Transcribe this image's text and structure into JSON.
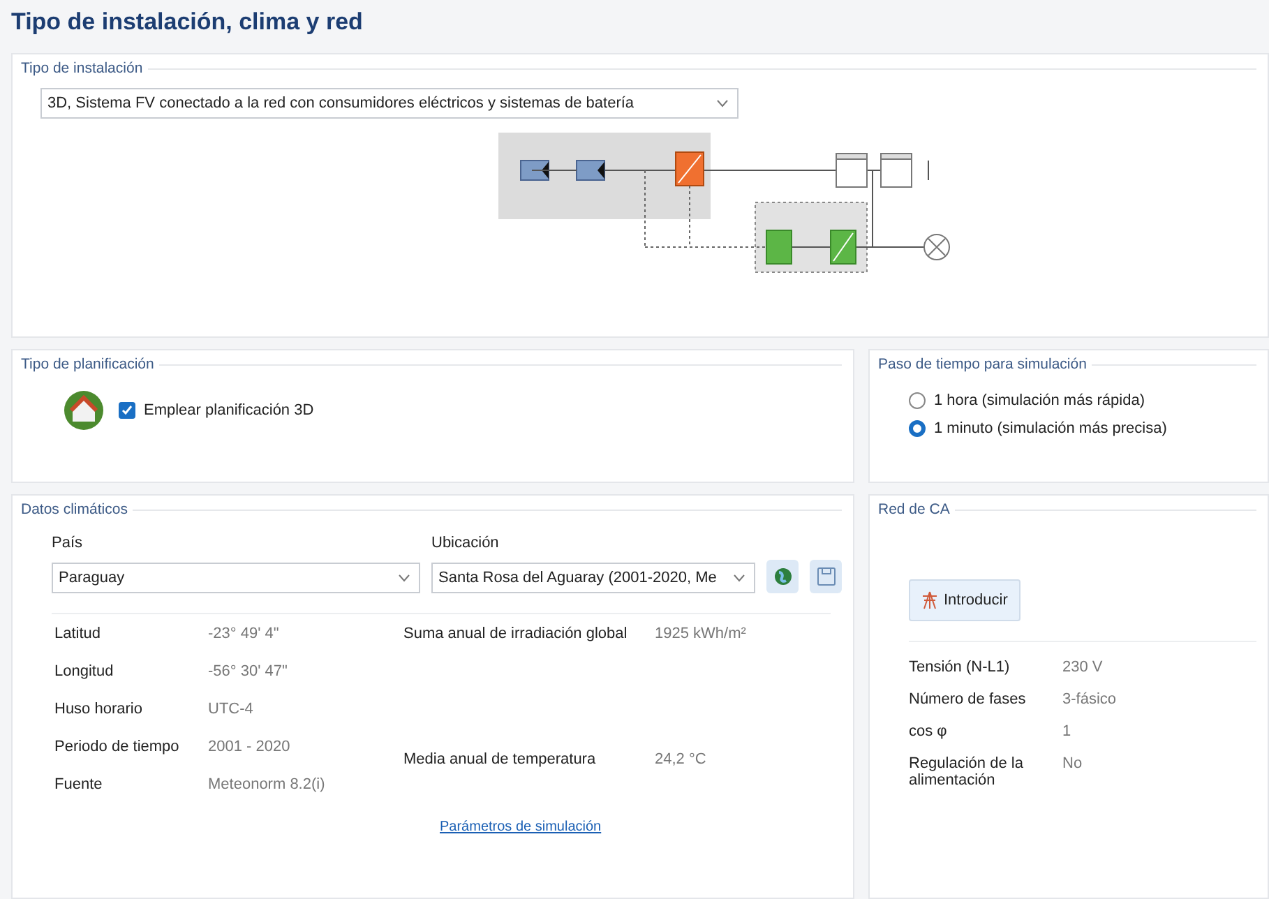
{
  "title": "Tipo de instalación, clima y red",
  "installation": {
    "label": "Tipo de instalación",
    "system_type": "3D, Sistema FV conectado a la red con consumidores eléctricos y sistemas de batería"
  },
  "planning": {
    "label": "Tipo de planificación",
    "checkbox": {
      "label": "Emplear planificación 3D",
      "checked": true
    }
  },
  "timestep": {
    "label": "Paso de tiempo para simulación",
    "options": [
      {
        "label": "1 hora (simulación más rápida)",
        "selected": false
      },
      {
        "label": "1 minuto (simulación más precisa)",
        "selected": true
      }
    ]
  },
  "climate": {
    "label": "Datos climáticos",
    "country_label": "País",
    "country": "Paraguay",
    "location_label": "Ubicación",
    "location": "Santa Rosa del Aguaray (2001-2020, Me",
    "left_rows": [
      {
        "label": "Latitud",
        "value": "-23° 49' 4\""
      },
      {
        "label": "Longitud",
        "value": "-56° 30' 47\""
      },
      {
        "label": "Huso horario",
        "value": "UTC-4"
      },
      {
        "label": "Periodo de tiempo",
        "value": "2001 - 2020"
      },
      {
        "label": "Fuente",
        "value": "Meteonorm 8.2(i)"
      }
    ],
    "right_rows": [
      {
        "label": "Suma anual de irradiación global",
        "value": "1925 kWh/m²"
      },
      {
        "label": "Media anual de temperatura",
        "value": "24,2 °C"
      }
    ],
    "link": "Parámetros de simulación"
  },
  "ac_grid": {
    "label": "Red de CA",
    "button": "Introducir",
    "rows": [
      {
        "label": "Tensión (N-L1)",
        "value": "230 V"
      },
      {
        "label": "Número de fases",
        "value": "3-fásico"
      },
      {
        "label": "cos φ",
        "value": "1"
      },
      {
        "label": "Regulación de la alimentación",
        "value": "No"
      }
    ]
  }
}
